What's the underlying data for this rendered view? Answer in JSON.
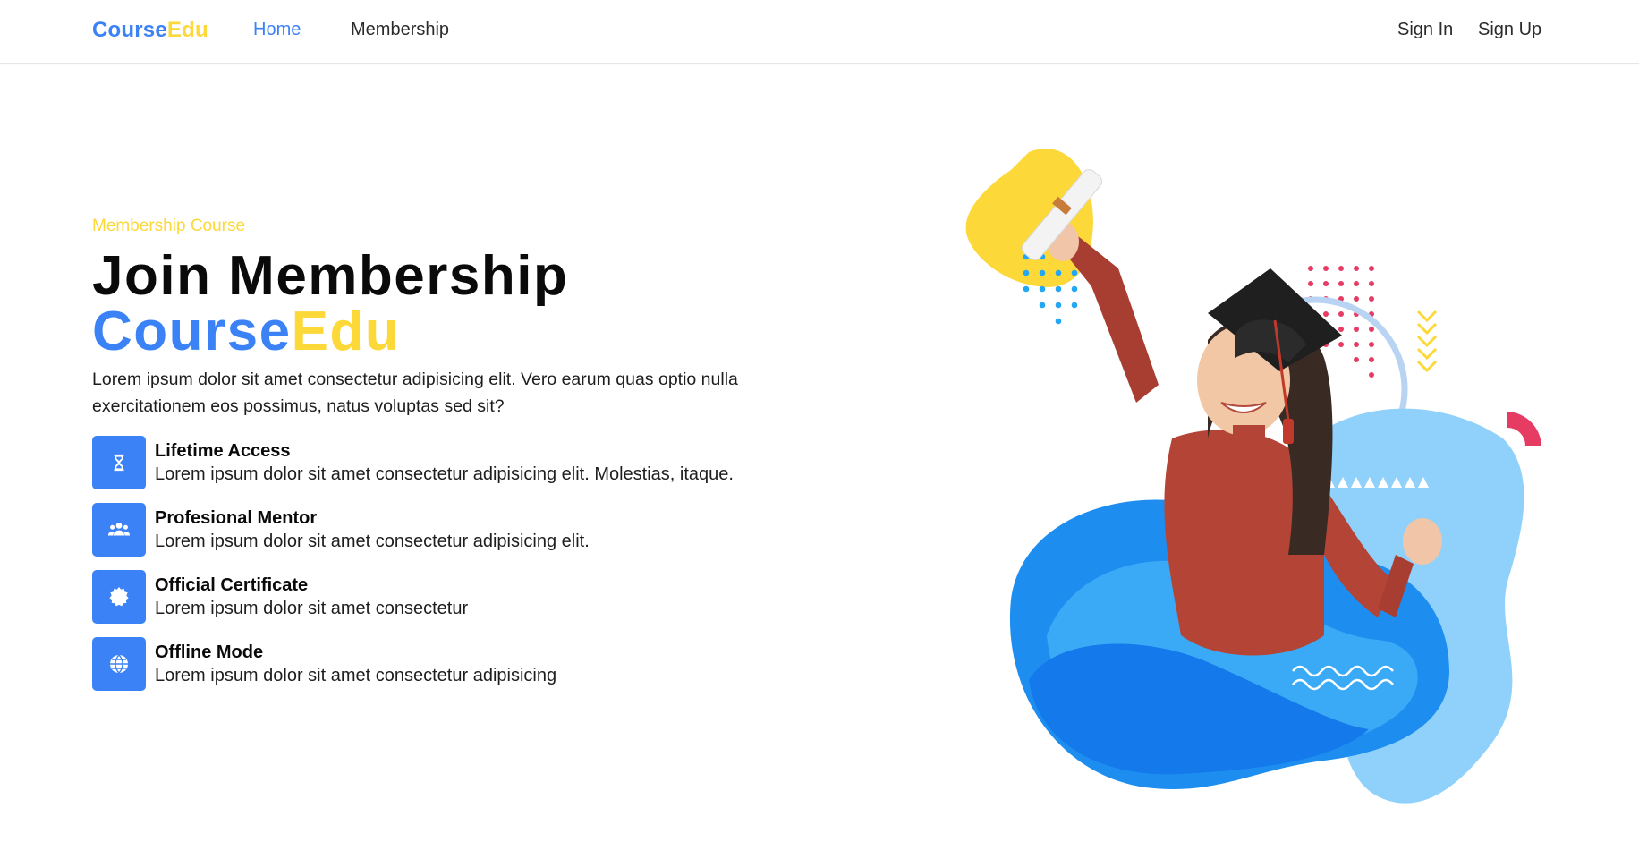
{
  "navbar": {
    "brand_part1": "Course",
    "brand_part2": "Edu",
    "links": [
      {
        "label": "Home",
        "active": true
      },
      {
        "label": "Membership",
        "active": false
      }
    ],
    "sign_in_label": "Sign In",
    "sign_up_label": "Sign Up"
  },
  "hero": {
    "eyebrow": "Membership Course",
    "headline_line1": "Join Membership",
    "headline_brand_part1": "Course",
    "headline_brand_part2": "Edu",
    "lead": "Lorem ipsum dolor sit amet consectetur adipisicing elit. Vero earum quas optio nulla exercitationem eos possimus, natus voluptas sed sit?",
    "features": [
      {
        "title": "Lifetime Access",
        "description": "Lorem ipsum dolor sit amet consectetur adipisicing elit. Molestias, itaque.",
        "icon": "hourglass-icon"
      },
      {
        "title": "Profesional Mentor",
        "description": "Lorem ipsum dolor sit amet consectetur adipisicing elit.",
        "icon": "users-icon"
      },
      {
        "title": "Official Certificate",
        "description": "Lorem ipsum dolor sit amet consectetur",
        "icon": "certificate-icon"
      },
      {
        "title": "Offline Mode",
        "description": "Lorem ipsum dolor sit amet consectetur adipisicing",
        "icon": "globe-icon"
      }
    ],
    "illustration": "graduate-student-illustration"
  },
  "colors": {
    "primary": "#3b82f6",
    "accent": "#fcd839",
    "text": "#0a0a0a"
  }
}
